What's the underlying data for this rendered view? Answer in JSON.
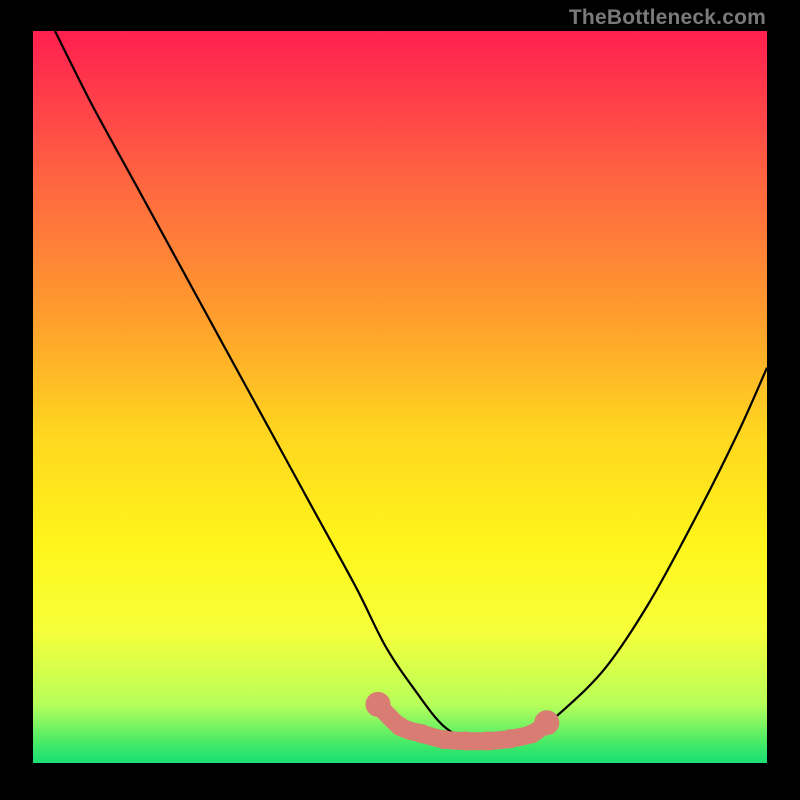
{
  "watermark": "TheBottleneck.com",
  "chart_data": {
    "type": "line",
    "title": "",
    "xlabel": "",
    "ylabel": "",
    "xlim": [
      0,
      100
    ],
    "ylim": [
      0,
      100
    ],
    "note": "Axes unlabeled in source image; values are relative positions (0=bottom/left, 100=top/right). Curve is a V-shaped bottleneck curve with minimum near x≈60.",
    "series": [
      {
        "name": "bottleneck-curve",
        "x": [
          3,
          8,
          14,
          20,
          26,
          32,
          38,
          44,
          48,
          52,
          56,
          60,
          64,
          68,
          72,
          78,
          84,
          90,
          96,
          100
        ],
        "y": [
          100,
          90,
          79,
          68,
          57,
          46,
          35,
          24,
          16,
          10,
          5,
          3,
          3,
          4,
          7,
          13,
          22,
          33,
          45,
          54
        ]
      }
    ],
    "markers": {
      "name": "highlight-region",
      "note": "Pink rounded markers along the curve floor (sweet-spot region).",
      "x": [
        47,
        50,
        53,
        56,
        59,
        62,
        65,
        68,
        70
      ],
      "y": [
        8,
        5,
        4,
        3.2,
        3,
        3,
        3.3,
        4,
        5.5
      ]
    },
    "gradient_stops": [
      {
        "pos": 0,
        "color": "#ff1f4f"
      },
      {
        "pos": 55,
        "color": "#ffd61f"
      },
      {
        "pos": 100,
        "color": "#1adf74"
      }
    ]
  }
}
